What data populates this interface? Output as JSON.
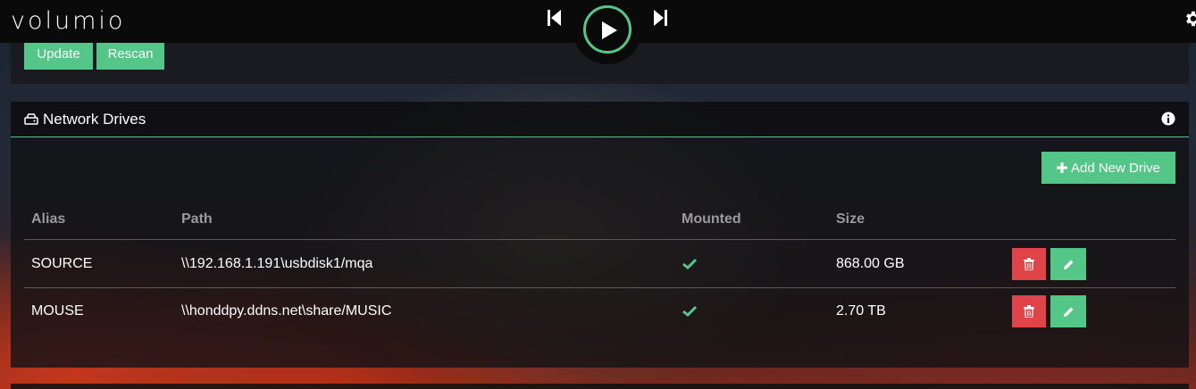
{
  "app": {
    "logo": "volumio"
  },
  "player": {
    "prev_icon": "skip-previous-icon",
    "play_icon": "play-icon",
    "next_icon": "skip-next-icon"
  },
  "header": {
    "settings_icon": "gear-icon"
  },
  "library_actions": {
    "update_label": "Update",
    "rescan_label": "Rescan"
  },
  "network_drives": {
    "title": "Network Drives",
    "add_button_label": "Add New Drive",
    "columns": {
      "alias": "Alias",
      "path": "Path",
      "mounted": "Mounted",
      "size": "Size"
    },
    "rows": [
      {
        "alias": "SOURCE",
        "path": "\\\\192.168.1.191\\usbdisk1/mqa",
        "mounted": true,
        "size": "868.00 GB"
      },
      {
        "alias": "MOUSE",
        "path": "\\\\honddpy.ddns.net\\share/MUSIC",
        "mounted": true,
        "size": "2.70 TB"
      }
    ]
  },
  "colors": {
    "accent": "#54c688",
    "danger": "#e04448",
    "topbar": "#0a0a0a"
  }
}
